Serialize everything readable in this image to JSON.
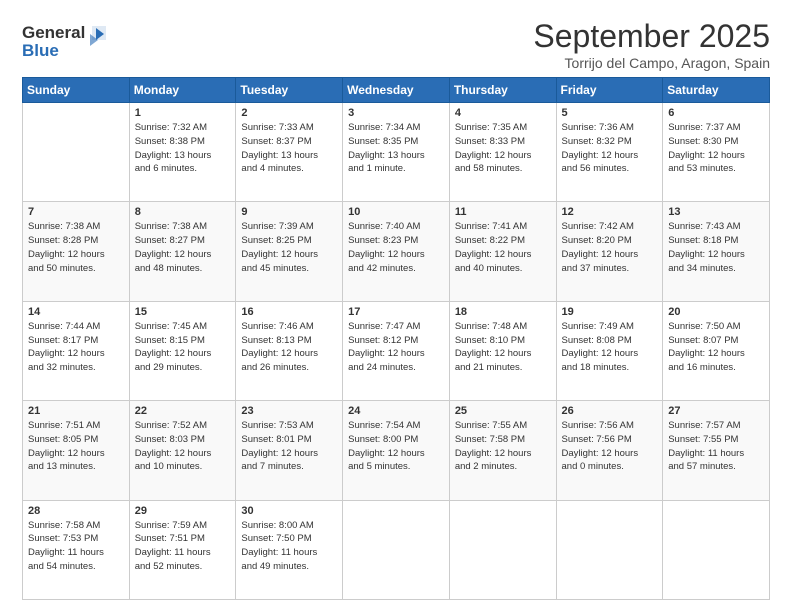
{
  "logo": {
    "line1": "General",
    "line2": "Blue"
  },
  "title": "September 2025",
  "location": "Torrijo del Campo, Aragon, Spain",
  "days_header": [
    "Sunday",
    "Monday",
    "Tuesday",
    "Wednesday",
    "Thursday",
    "Friday",
    "Saturday"
  ],
  "weeks": [
    [
      {
        "num": "",
        "info": ""
      },
      {
        "num": "1",
        "info": "Sunrise: 7:32 AM\nSunset: 8:38 PM\nDaylight: 13 hours\nand 6 minutes."
      },
      {
        "num": "2",
        "info": "Sunrise: 7:33 AM\nSunset: 8:37 PM\nDaylight: 13 hours\nand 4 minutes."
      },
      {
        "num": "3",
        "info": "Sunrise: 7:34 AM\nSunset: 8:35 PM\nDaylight: 13 hours\nand 1 minute."
      },
      {
        "num": "4",
        "info": "Sunrise: 7:35 AM\nSunset: 8:33 PM\nDaylight: 12 hours\nand 58 minutes."
      },
      {
        "num": "5",
        "info": "Sunrise: 7:36 AM\nSunset: 8:32 PM\nDaylight: 12 hours\nand 56 minutes."
      },
      {
        "num": "6",
        "info": "Sunrise: 7:37 AM\nSunset: 8:30 PM\nDaylight: 12 hours\nand 53 minutes."
      }
    ],
    [
      {
        "num": "7",
        "info": "Sunrise: 7:38 AM\nSunset: 8:28 PM\nDaylight: 12 hours\nand 50 minutes."
      },
      {
        "num": "8",
        "info": "Sunrise: 7:38 AM\nSunset: 8:27 PM\nDaylight: 12 hours\nand 48 minutes."
      },
      {
        "num": "9",
        "info": "Sunrise: 7:39 AM\nSunset: 8:25 PM\nDaylight: 12 hours\nand 45 minutes."
      },
      {
        "num": "10",
        "info": "Sunrise: 7:40 AM\nSunset: 8:23 PM\nDaylight: 12 hours\nand 42 minutes."
      },
      {
        "num": "11",
        "info": "Sunrise: 7:41 AM\nSunset: 8:22 PM\nDaylight: 12 hours\nand 40 minutes."
      },
      {
        "num": "12",
        "info": "Sunrise: 7:42 AM\nSunset: 8:20 PM\nDaylight: 12 hours\nand 37 minutes."
      },
      {
        "num": "13",
        "info": "Sunrise: 7:43 AM\nSunset: 8:18 PM\nDaylight: 12 hours\nand 34 minutes."
      }
    ],
    [
      {
        "num": "14",
        "info": "Sunrise: 7:44 AM\nSunset: 8:17 PM\nDaylight: 12 hours\nand 32 minutes."
      },
      {
        "num": "15",
        "info": "Sunrise: 7:45 AM\nSunset: 8:15 PM\nDaylight: 12 hours\nand 29 minutes."
      },
      {
        "num": "16",
        "info": "Sunrise: 7:46 AM\nSunset: 8:13 PM\nDaylight: 12 hours\nand 26 minutes."
      },
      {
        "num": "17",
        "info": "Sunrise: 7:47 AM\nSunset: 8:12 PM\nDaylight: 12 hours\nand 24 minutes."
      },
      {
        "num": "18",
        "info": "Sunrise: 7:48 AM\nSunset: 8:10 PM\nDaylight: 12 hours\nand 21 minutes."
      },
      {
        "num": "19",
        "info": "Sunrise: 7:49 AM\nSunset: 8:08 PM\nDaylight: 12 hours\nand 18 minutes."
      },
      {
        "num": "20",
        "info": "Sunrise: 7:50 AM\nSunset: 8:07 PM\nDaylight: 12 hours\nand 16 minutes."
      }
    ],
    [
      {
        "num": "21",
        "info": "Sunrise: 7:51 AM\nSunset: 8:05 PM\nDaylight: 12 hours\nand 13 minutes."
      },
      {
        "num": "22",
        "info": "Sunrise: 7:52 AM\nSunset: 8:03 PM\nDaylight: 12 hours\nand 10 minutes."
      },
      {
        "num": "23",
        "info": "Sunrise: 7:53 AM\nSunset: 8:01 PM\nDaylight: 12 hours\nand 7 minutes."
      },
      {
        "num": "24",
        "info": "Sunrise: 7:54 AM\nSunset: 8:00 PM\nDaylight: 12 hours\nand 5 minutes."
      },
      {
        "num": "25",
        "info": "Sunrise: 7:55 AM\nSunset: 7:58 PM\nDaylight: 12 hours\nand 2 minutes."
      },
      {
        "num": "26",
        "info": "Sunrise: 7:56 AM\nSunset: 7:56 PM\nDaylight: 12 hours\nand 0 minutes."
      },
      {
        "num": "27",
        "info": "Sunrise: 7:57 AM\nSunset: 7:55 PM\nDaylight: 11 hours\nand 57 minutes."
      }
    ],
    [
      {
        "num": "28",
        "info": "Sunrise: 7:58 AM\nSunset: 7:53 PM\nDaylight: 11 hours\nand 54 minutes."
      },
      {
        "num": "29",
        "info": "Sunrise: 7:59 AM\nSunset: 7:51 PM\nDaylight: 11 hours\nand 52 minutes."
      },
      {
        "num": "30",
        "info": "Sunrise: 8:00 AM\nSunset: 7:50 PM\nDaylight: 11 hours\nand 49 minutes."
      },
      {
        "num": "",
        "info": ""
      },
      {
        "num": "",
        "info": ""
      },
      {
        "num": "",
        "info": ""
      },
      {
        "num": "",
        "info": ""
      }
    ]
  ]
}
